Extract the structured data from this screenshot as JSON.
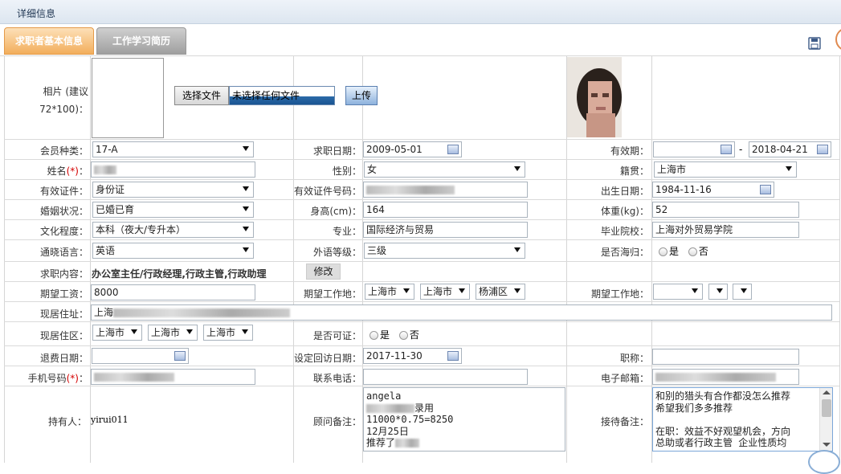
{
  "window": {
    "title": "详细信息"
  },
  "tabs": [
    {
      "label": "求职者基本信息"
    },
    {
      "label": "工作学习简历"
    }
  ],
  "photo": {
    "label": "相片 (建议72*100)：",
    "label_line1": "相片 (建议",
    "label_line2": "72*100)：",
    "choose_btn": "选择文件",
    "no_file": "未选择任何文件",
    "upload_btn": "上传"
  },
  "rows": {
    "member_type": {
      "label": "会员种类：",
      "value": "17-A"
    },
    "job_date": {
      "label": "求职日期：",
      "value": "2009-05-01"
    },
    "valid_period": {
      "label": "有效期：",
      "from": "",
      "sep": "-",
      "to": "2018-04-21"
    },
    "name": {
      "label": "姓名",
      "req": "(*)",
      "colon": "：",
      "value": ""
    },
    "gender": {
      "label": "性别：",
      "value": "女"
    },
    "native": {
      "label": "籍贯：",
      "value": "上海市"
    },
    "id_type": {
      "label": "有效证件：",
      "value": "身份证"
    },
    "id_no": {
      "label": "有效证件号码：",
      "value": ""
    },
    "birth": {
      "label": "出生日期：",
      "value": "1984-11-16"
    },
    "marriage": {
      "label": "婚姻状况：",
      "value": "已婚已育"
    },
    "height": {
      "label": "身高(cm)：",
      "value": "164"
    },
    "weight": {
      "label": "体重(kg)：",
      "value": "52"
    },
    "education": {
      "label": "文化程度：",
      "value": "本科（夜大/专升本）"
    },
    "major": {
      "label": "专业：",
      "value": "国际经济与贸易"
    },
    "school": {
      "label": "毕业院校：",
      "value": "上海对外贸易学院"
    },
    "language": {
      "label": "通晓语言：",
      "value": "英语"
    },
    "lang_level": {
      "label": "外语等级：",
      "value": "三级"
    },
    "returnee": {
      "label": "是否海归：",
      "yes": "是",
      "no": "否"
    },
    "job_content": {
      "label": "求职内容：",
      "value": "办公室主任/行政经理,行政主管,行政助理",
      "edit_btn": "修改"
    },
    "salary": {
      "label": "期望工资：",
      "value": "8000"
    },
    "work_place1": {
      "label": "期望工作地：",
      "prov": "上海市",
      "city": "上海市",
      "district": "杨浦区"
    },
    "work_place2": {
      "label": "期望工作地：",
      "prov": "",
      "city": "",
      "district": ""
    },
    "address": {
      "label": "现居住址：",
      "value": "上海"
    },
    "residence": {
      "label": "现居住区：",
      "prov": "上海市",
      "city": "上海市",
      "district": "上海市"
    },
    "available": {
      "label": "是否可证：",
      "yes": "是",
      "no": "否"
    },
    "refund_date": {
      "label": "退费日期：",
      "value": ""
    },
    "revisit_date": {
      "label": "设定回访日期：",
      "value": "2017-11-30"
    },
    "title": {
      "label": "职称：",
      "value": ""
    },
    "mobile": {
      "label": "手机号码",
      "req": "(*)",
      "colon": "：",
      "value": ""
    },
    "phone": {
      "label": "联系电话：",
      "value": ""
    },
    "email": {
      "label": "电子邮箱：",
      "value": ""
    },
    "holder": {
      "label": "持有人：",
      "value": "yirui011"
    },
    "consultant_note": {
      "label": "顾问备注：",
      "l1": "angela",
      "l2": "录用",
      "l3": "11000*0.75=8250",
      "l4": "12月25日",
      "l5": "推荐了"
    },
    "reception_note": {
      "label": "接待备注：",
      "l1": "和别的猎头有合作都没怎么推荐",
      "l2": "希望我们多多推荐",
      "l3": "",
      "l4": "在职：效益不好观望机会，方向",
      "l5": "总助或者行政主管 企业性质均"
    }
  },
  "colors": {
    "req": "#d40000",
    "tab_active": "#f2ae5c",
    "tab_inactive": "#9f9f9f"
  },
  "icons": [
    "save-icon",
    "calendar-icon",
    "dropdown-arrow-icon",
    "radio-icon"
  ]
}
